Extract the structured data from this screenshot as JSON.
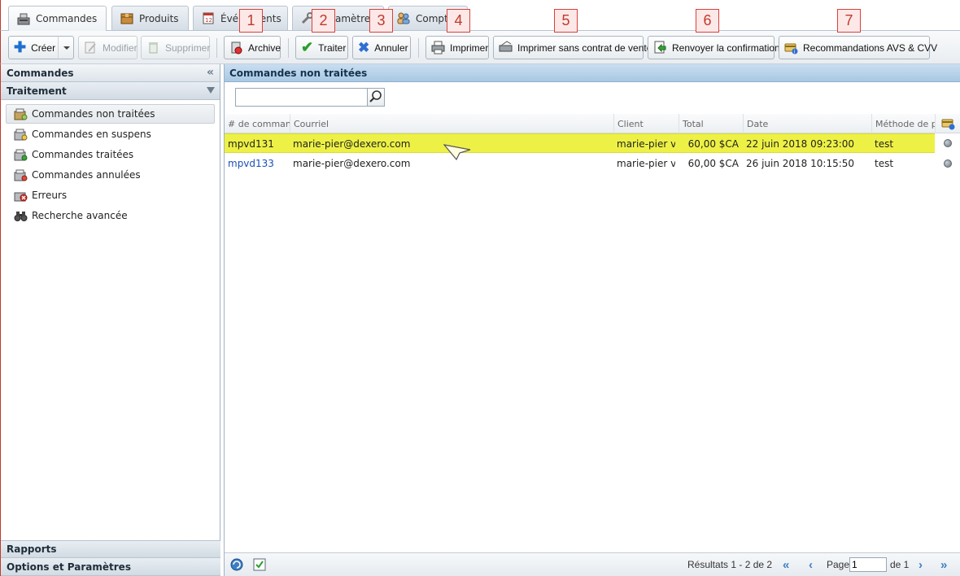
{
  "tabs": [
    {
      "label": "Commandes",
      "icon": "register-icon",
      "active": true
    },
    {
      "label": "Produits",
      "icon": "box-icon"
    },
    {
      "label": "Événements",
      "icon": "calendar-icon"
    },
    {
      "label": "Paramètres",
      "icon": "wrench-icon"
    },
    {
      "label": "Comptes",
      "icon": "users-icon"
    }
  ],
  "toolbar": {
    "create": "Créer",
    "modify": "Modifier",
    "delete": "Supprimer",
    "archive": "Archive",
    "process": "Traiter",
    "cancel": "Annuler",
    "print": "Imprimer",
    "print_no_contract": "Imprimer sans contrat de vente",
    "resend": "Renvoyer la confirmation",
    "avs": "Recommandations AVS & CVV"
  },
  "callouts": [
    "1",
    "2",
    "3",
    "4",
    "5",
    "6",
    "7"
  ],
  "left": {
    "title": "Commandes",
    "section": "Traitement",
    "items": [
      {
        "label": "Commandes non traitées",
        "icon": "orders-unprocessed-icon",
        "selected": true
      },
      {
        "label": "Commandes en suspens",
        "icon": "orders-pending-icon"
      },
      {
        "label": "Commandes traitées",
        "icon": "orders-processed-icon"
      },
      {
        "label": "Commandes annulées",
        "icon": "orders-cancelled-icon"
      },
      {
        "label": "Erreurs",
        "icon": "error-icon"
      },
      {
        "label": "Recherche avancée",
        "icon": "binoculars-icon"
      }
    ],
    "bottom": [
      "Rapports",
      "Options et Paramètres"
    ]
  },
  "main": {
    "title": "Commandes non traitées",
    "search_value": "",
    "columns": [
      "# de commande",
      "Courriel",
      "Client",
      "Total",
      "Date",
      "Méthode de paiement"
    ],
    "rows": [
      {
        "id": "mpvd131",
        "email": "marie-pier@dexero.com",
        "client": "marie-pier vo",
        "total": "60,00 $CA",
        "date": "22 juin 2018 09:23:00",
        "method": "test",
        "highlighted": true
      },
      {
        "id": "mpvd133",
        "email": "marie-pier@dexero.com",
        "client": "marie-pier vo",
        "total": "60,00 $CA",
        "date": "26 juin 2018 10:15:50",
        "method": "test",
        "highlighted": false
      }
    ]
  },
  "footer": {
    "results": "Résultats 1 - 2 de 2",
    "page_label": "Page",
    "page_value": "1",
    "of_label": "de 1"
  },
  "colors": {
    "highlight": "#eef145",
    "panel_title": "#a9c8e3",
    "callout_border": "#d9413a",
    "link": "#1b4fb8"
  }
}
